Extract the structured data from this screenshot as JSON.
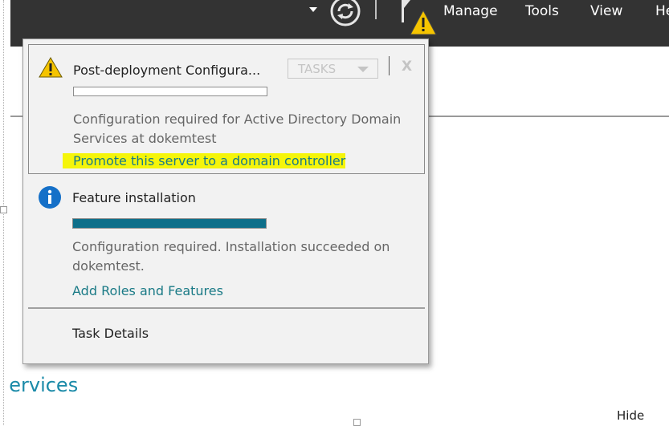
{
  "menu": {
    "items": [
      {
        "label": "Manage"
      },
      {
        "label": "Tools"
      },
      {
        "label": "View"
      },
      {
        "label": "He"
      }
    ]
  },
  "icons": {
    "dropdown": "chevron-down-icon",
    "refresh": "refresh-icon",
    "notifications": "flag-warning-icon",
    "warning": "warning-icon",
    "info": "info-icon",
    "close": "close-icon"
  },
  "colors": {
    "topbar": "#333333",
    "link": "#1a7a86",
    "highlight": "#f5f50a",
    "progress_fill": "#0e6f8a",
    "warning": "#f5c400",
    "info": "#1570c8"
  },
  "notifications": [
    {
      "title": "Post-deployment Configura...",
      "tasks_label": "TASKS",
      "close_label": "X",
      "progress": 0,
      "description": "Configuration required for Active Directory Domain Services at dokemtest",
      "link": "Promote this server to a domain controller"
    },
    {
      "title": "Feature installation",
      "progress": 1.0,
      "description": "Configuration required. Installation succeeded on dokemtest.",
      "link": "Add Roles and Features"
    }
  ],
  "task_details_label": "Task Details",
  "background": {
    "services_text": "Services",
    "hide_label": "Hide"
  }
}
